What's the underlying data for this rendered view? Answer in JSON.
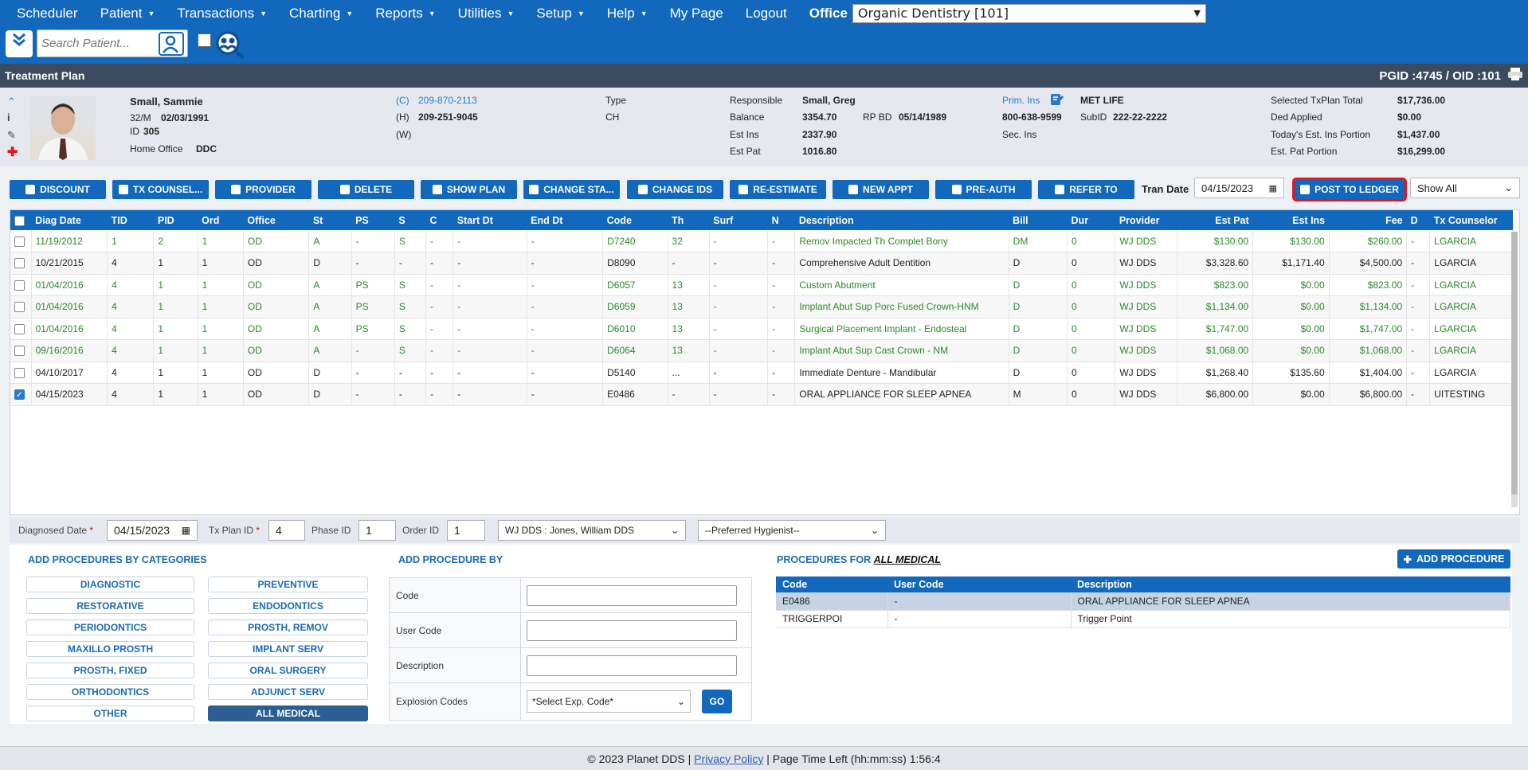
{
  "nav": {
    "items": [
      {
        "label": "Scheduler",
        "caret": false
      },
      {
        "label": "Patient",
        "caret": true
      },
      {
        "label": "Transactions",
        "caret": true
      },
      {
        "label": "Charting",
        "caret": true
      },
      {
        "label": "Reports",
        "caret": true
      },
      {
        "label": "Utilities",
        "caret": true
      },
      {
        "label": "Setup",
        "caret": true
      },
      {
        "label": "Help",
        "caret": true
      },
      {
        "label": "My Page",
        "caret": false
      },
      {
        "label": "Logout",
        "caret": false
      }
    ],
    "office_label": "Office",
    "office_value": "Organic Dentistry [101]"
  },
  "toolbar": {
    "search_placeholder": "Search Patient..."
  },
  "title": {
    "text": "Treatment Plan",
    "pgid": "PGID :4745  /  OID :101"
  },
  "patient": {
    "name": "Small, Sammie",
    "sexage": "32/M",
    "dob": "02/03/1991",
    "id_label": "ID",
    "id": "305",
    "home_office_label": "Home Office",
    "home_office": "DDC",
    "phone_c_label": "(C)",
    "phone_c": "209-870-2113",
    "phone_h_label": "(H)",
    "phone_h": "209-251-9045",
    "phone_w_label": "(W)",
    "type_label": "Type",
    "type": "CH",
    "responsible_label": "Responsible",
    "responsible": "Small, Greg",
    "balance_label": "Balance",
    "balance": "3354.70",
    "rpbd_label": "RP BD",
    "rpbd": "05/14/1989",
    "estins_label": "Est Ins",
    "estins": "2337.90",
    "estpat_label": "Est Pat",
    "estpat": "1016.80",
    "primins_label": "Prim. Ins",
    "primins": "MET LIFE",
    "primins_phone": "800-638-9599",
    "subid_label": "SubID",
    "subid": "222-22-2222",
    "secins_label": "Sec. Ins",
    "sel_total_label": "Selected TxPlan Total",
    "sel_total": "$17,736.00",
    "ded_label": "Ded Applied",
    "ded": "$0.00",
    "today_ins_label": "Today's Est. Ins Portion",
    "today_ins": "$1,437.00",
    "est_pat_portion_label": "Est. Pat Portion",
    "est_pat_portion": "$16,299.00"
  },
  "actions": {
    "buttons": [
      "DISCOUNT",
      "TX COUNSEL...",
      "PROVIDER",
      "DELETE",
      "SHOW PLAN",
      "CHANGE STA...",
      "CHANGE IDS",
      "RE-ESTIMATE",
      "NEW APPT",
      "PRE-AUTH",
      "REFER TO"
    ],
    "tran_date_label": "Tran Date",
    "tran_date": "04/15/2023",
    "post_label": "POST TO LEDGER",
    "show_all": "Show All"
  },
  "grid": {
    "headers": [
      "Diag Date",
      "TID",
      "PID",
      "Ord",
      "Office",
      "St",
      "PS",
      "S",
      "C",
      "Start Dt",
      "End Dt",
      "Code",
      "Th",
      "Surf",
      "N",
      "Description",
      "Bill",
      "Dur",
      "Provider",
      "Est Pat",
      "Est Ins",
      "Fee",
      "D",
      "Tx Counselor"
    ],
    "rows": [
      {
        "checked": false,
        "green": true,
        "cells": [
          "11/19/2012",
          "1",
          "2",
          "1",
          "OD",
          "A",
          "-",
          "S",
          "-",
          "-",
          "-",
          "D7240",
          "32",
          "-",
          "-",
          "Remov Impacted Th Complet Bony",
          "DM",
          "0",
          "WJ DDS",
          "$130.00",
          "$130.00",
          "$260.00",
          "-",
          "LGARCIA"
        ]
      },
      {
        "checked": false,
        "green": false,
        "cells": [
          "10/21/2015",
          "4",
          "1",
          "1",
          "OD",
          "D",
          "-",
          "-",
          "-",
          "-",
          "-",
          "D8090",
          "-",
          "-",
          "-",
          "Comprehensive Adult Dentition",
          "D",
          "0",
          "WJ DDS",
          "$3,328.60",
          "$1,171.40",
          "$4,500.00",
          "-",
          "LGARCIA"
        ]
      },
      {
        "checked": false,
        "green": true,
        "cells": [
          "01/04/2016",
          "4",
          "1",
          "1",
          "OD",
          "A",
          "PS",
          "S",
          "-",
          "-",
          "-",
          "D6057",
          "13",
          "-",
          "-",
          "Custom Abutment",
          "D",
          "0",
          "WJ DDS",
          "$823.00",
          "$0.00",
          "$823.00",
          "-",
          "LGARCIA"
        ]
      },
      {
        "checked": false,
        "green": true,
        "cells": [
          "01/04/2016",
          "4",
          "1",
          "1",
          "OD",
          "A",
          "PS",
          "S",
          "-",
          "-",
          "-",
          "D6059",
          "13",
          "-",
          "-",
          "Implant Abut Sup Porc Fused Crown-HNM",
          "D",
          "0",
          "WJ DDS",
          "$1,134.00",
          "$0.00",
          "$1,134.00",
          "-",
          "LGARCIA"
        ]
      },
      {
        "checked": false,
        "green": true,
        "cells": [
          "01/04/2016",
          "4",
          "1",
          "1",
          "OD",
          "A",
          "PS",
          "S",
          "-",
          "-",
          "-",
          "D6010",
          "13",
          "-",
          "-",
          "Surgical Placement Implant - Endosteal",
          "D",
          "0",
          "WJ DDS",
          "$1,747.00",
          "$0.00",
          "$1,747.00",
          "-",
          "LGARCIA"
        ]
      },
      {
        "checked": false,
        "green": true,
        "cells": [
          "09/16/2016",
          "4",
          "1",
          "1",
          "OD",
          "A",
          "-",
          "S",
          "-",
          "-",
          "-",
          "D6064",
          "13",
          "-",
          "-",
          "Implant Abut Sup Cast Crown - NM",
          "D",
          "0",
          "WJ DDS",
          "$1,068.00",
          "$0.00",
          "$1,068.00",
          "-",
          "LGARCIA"
        ]
      },
      {
        "checked": false,
        "green": false,
        "cells": [
          "04/10/2017",
          "4",
          "1",
          "1",
          "OD",
          "D",
          "-",
          "-",
          "-",
          "-",
          "-",
          "D5140",
          "...",
          "-",
          "-",
          "Immediate Denture - Mandibular",
          "D",
          "0",
          "WJ DDS",
          "$1,268.40",
          "$135.60",
          "$1,404.00",
          "-",
          "LGARCIA"
        ]
      },
      {
        "checked": true,
        "green": false,
        "cells": [
          "04/15/2023",
          "4",
          "1",
          "1",
          "OD",
          "D",
          "-",
          "-",
          "-",
          "-",
          "-",
          "E0486",
          "-",
          "-",
          "-",
          "ORAL APPLIANCE FOR SLEEP APNEA",
          "M",
          "0",
          "WJ DDS",
          "$6,800.00",
          "$0.00",
          "$6,800.00",
          "-",
          "UITESTING"
        ]
      }
    ]
  },
  "detail": {
    "diag_label": "Diagnosed Date",
    "diag": "04/15/2023",
    "txplan_label": "Tx Plan ID",
    "txplan": "4",
    "phase_label": "Phase ID",
    "phase": "1",
    "order_label": "Order ID",
    "order": "1",
    "provider": "WJ DDS : Jones, William DDS",
    "hygienist": "--Preferred Hygienist--"
  },
  "categories": {
    "title": "ADD PROCEDURES BY CATEGORIES",
    "left": [
      "DIAGNOSTIC",
      "RESTORATIVE",
      "PERIODONTICS",
      "MAXILLO PROSTH",
      "PROSTH, FIXED",
      "ORTHODONTICS",
      "OTHER"
    ],
    "right": [
      "PREVENTIVE",
      "ENDODONTICS",
      "PROSTH, REMOV",
      "IMPLANT SERV",
      "ORAL SURGERY",
      "ADJUNCT SERV",
      "ALL MEDICAL"
    ]
  },
  "addby": {
    "title": "ADD PROCEDURE BY",
    "code": "Code",
    "user_code": "User Code",
    "description": "Description",
    "explosion": "Explosion Codes",
    "exp_select": "*Select Exp. Code*",
    "go": "GO"
  },
  "procfor": {
    "title": "PROCEDURES FOR",
    "category": "ALL MEDICAL",
    "add_label": "ADD PROCEDURE",
    "headers": [
      "Code",
      "User Code",
      "Description"
    ],
    "rows": [
      [
        "E0486",
        "-",
        "ORAL APPLIANCE FOR SLEEP APNEA"
      ],
      [
        "TRIGGERPOI",
        "-",
        "Trigger Point"
      ]
    ]
  },
  "footer": {
    "copy": "© 2023 Planet DDS |",
    "privacy": "Privacy Policy",
    "rest": "|  Page Time Left (hh:mm:ss) 1:56:4"
  }
}
